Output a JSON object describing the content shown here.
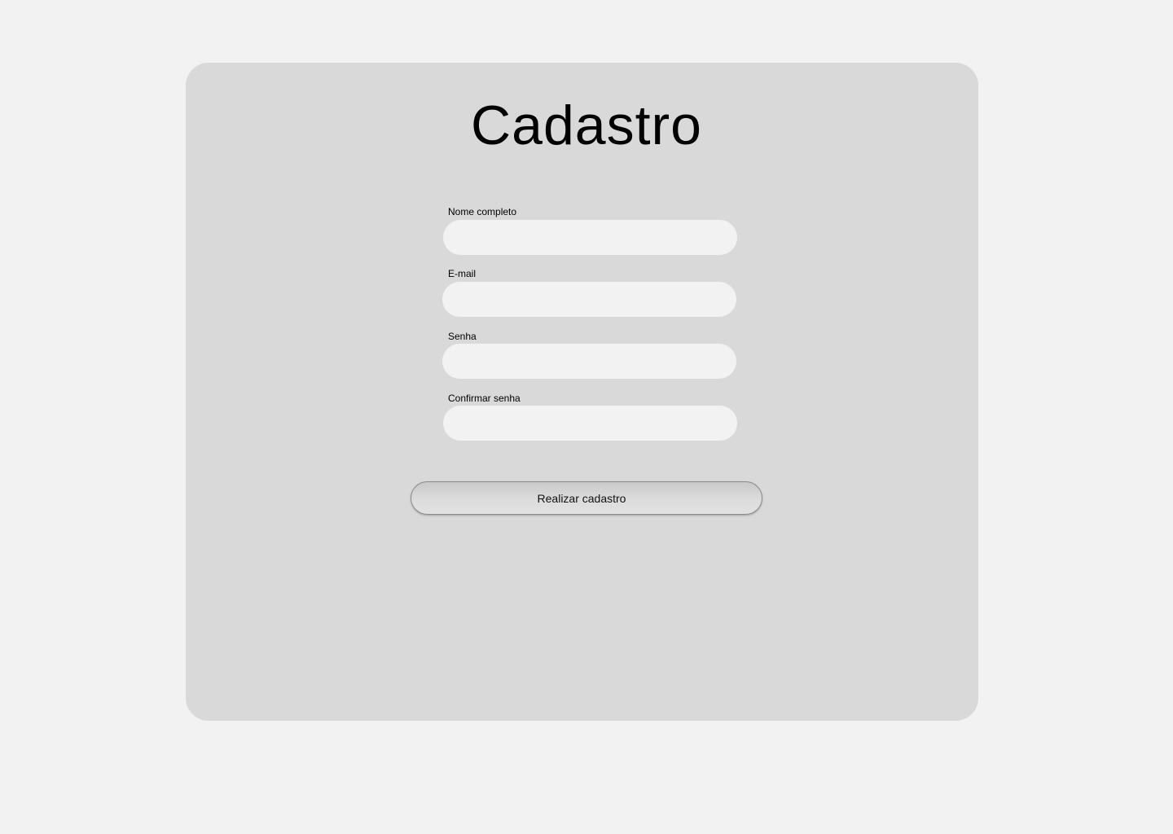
{
  "form": {
    "title": "Cadastro",
    "fields": [
      {
        "label": "Nome completo",
        "value": "",
        "placeholder": ""
      },
      {
        "label": "E-mail",
        "value": "",
        "placeholder": ""
      },
      {
        "label": "Senha",
        "value": "",
        "placeholder": ""
      },
      {
        "label": "Confirmar senha",
        "value": "",
        "placeholder": ""
      }
    ],
    "submit_label": "Realizar cadastro"
  },
  "colors": {
    "page_background": "#f2f2f2",
    "card_background": "#d9d9d9",
    "input_background": "#f2f2f2"
  }
}
